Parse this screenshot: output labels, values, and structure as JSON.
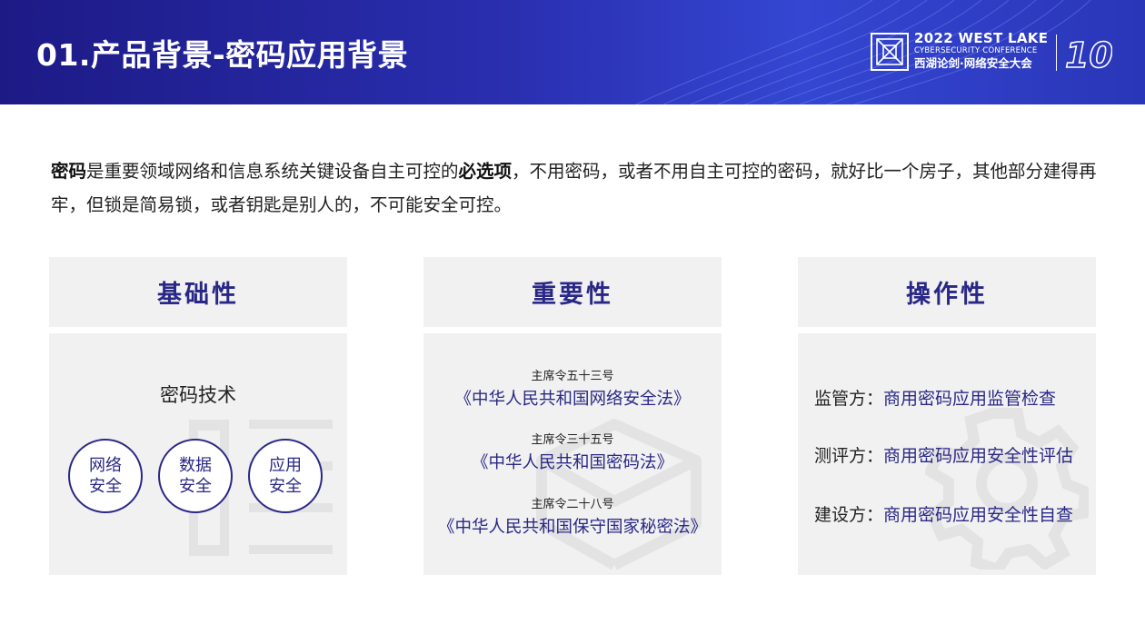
{
  "header": {
    "title": "01.产品背景-密码应用背景",
    "logo": {
      "line1": "2022 WEST LAKE",
      "line2": "CYBERSECURITY CONFERENCE",
      "line3": "西湖论剑·网络安全大会",
      "anniversary_mark": "10"
    }
  },
  "intro": {
    "bold1": "密码",
    "text1": "是重要领域网络和信息系统关键设备自主可控的",
    "bold2": "必选项",
    "text2": "，不用密码，或者不用自主可控的密码，就好比一个房子，其他部分建得再牢，但锁是简易锁，或者钥匙是别人的，不可能安全可控。"
  },
  "columns": {
    "basic": {
      "title": "基础性",
      "tech_label": "密码技术",
      "circles": [
        "网络安全",
        "数据安全",
        "应用安全"
      ]
    },
    "importance": {
      "title": "重要性",
      "laws": [
        {
          "order": "主席令五十三号",
          "name": "《中华人民共和国网络安全法》"
        },
        {
          "order": "主席令三十五号",
          "name": "《中华人民共和国密码法》"
        },
        {
          "order": "主席令二十八号",
          "name": "《中华人民共和国保守国家秘密法》"
        }
      ]
    },
    "operation": {
      "title": "操作性",
      "rows": [
        {
          "role": "监管方：",
          "task": "商用密码应用监管检查"
        },
        {
          "role": "测评方：",
          "task": "商用密码应用安全性评估"
        },
        {
          "role": "建设方：",
          "task": "商用密码应用安全性自查"
        }
      ]
    }
  },
  "colors": {
    "header_start": "#1d1a86",
    "header_end": "#3446d2",
    "accent": "#2a2886",
    "panel_bg": "#f1f1f1"
  }
}
